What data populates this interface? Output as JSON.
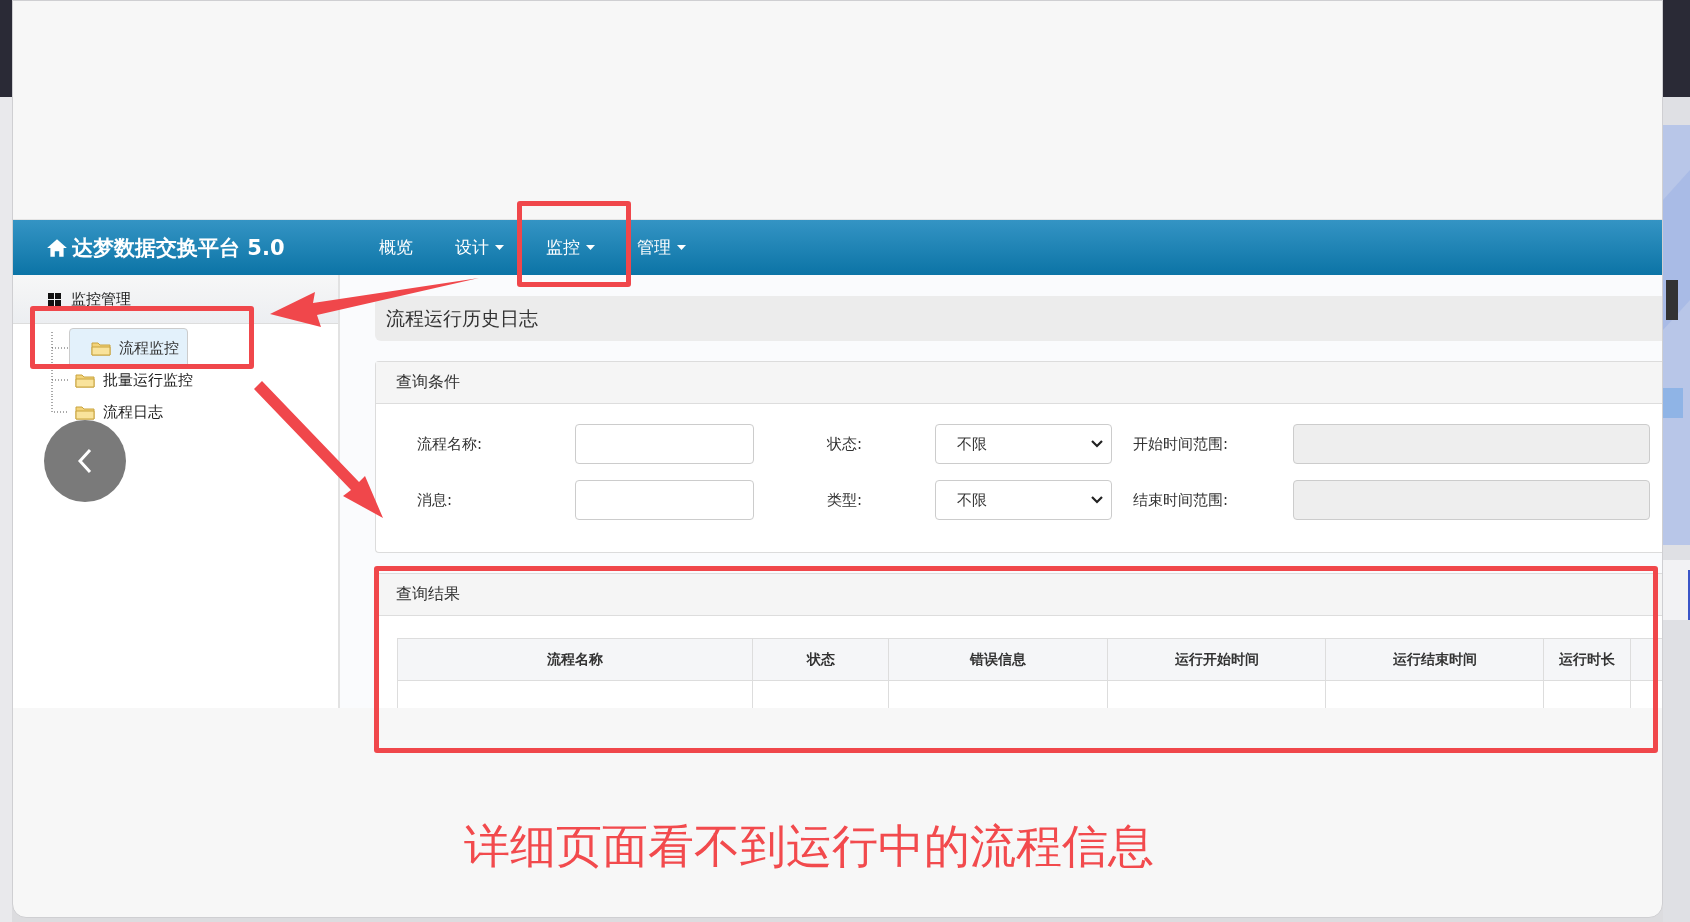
{
  "navbar": {
    "brand": "达梦数据交换平台 5.0",
    "menu": [
      {
        "label": "概览",
        "dropdown": false
      },
      {
        "label": "设计",
        "dropdown": true
      },
      {
        "label": "监控",
        "dropdown": true
      },
      {
        "label": "管理",
        "dropdown": true
      }
    ]
  },
  "sidebar": {
    "title": "监控管理",
    "items": [
      {
        "label": "流程监控",
        "selected": true
      },
      {
        "label": "批量运行监控",
        "selected": false
      },
      {
        "label": "流程日志",
        "selected": false
      }
    ]
  },
  "page_title": "流程运行历史日志",
  "query": {
    "title": "查询条件",
    "fields": [
      {
        "label": "流程名称:",
        "kind": "text"
      },
      {
        "label": "状态:",
        "kind": "select",
        "value": "不限"
      },
      {
        "label": "开始时间范围:",
        "kind": "range"
      },
      {
        "label": "消息:",
        "kind": "text"
      },
      {
        "label": "类型:",
        "kind": "select",
        "value": "不限"
      },
      {
        "label": "结束时间范围:",
        "kind": "range"
      }
    ]
  },
  "results": {
    "title": "查询结果",
    "columns": [
      "流程名称",
      "状态",
      "错误信息",
      "运行开始时间",
      "运行结束时间",
      "运行时长"
    ]
  },
  "annotation": {
    "caption": "详细页面看不到运行中的流程信息"
  }
}
